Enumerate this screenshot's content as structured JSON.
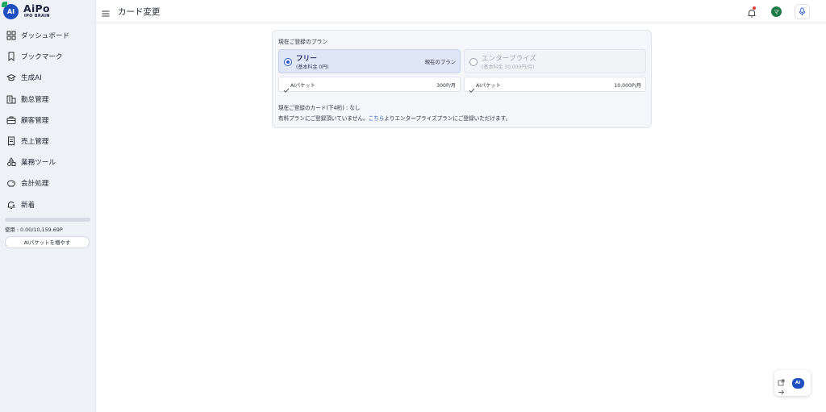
{
  "brand": {
    "badge": "AI",
    "name": "AiPo",
    "sub": "IPO BRAIN"
  },
  "sidebar": {
    "items": [
      {
        "label": "ダッシュボード",
        "icon": "dashboard-icon"
      },
      {
        "label": "ブックマーク",
        "icon": "bookmark-icon"
      },
      {
        "label": "生成AI",
        "icon": "graduation-cap-icon"
      },
      {
        "label": "勤怠管理",
        "icon": "building-icon"
      },
      {
        "label": "顧客管理",
        "icon": "briefcase-icon"
      },
      {
        "label": "売上管理",
        "icon": "receipt-icon"
      },
      {
        "label": "業務ツール",
        "icon": "shapes-icon"
      },
      {
        "label": "会計処理",
        "icon": "piggy-bank-icon"
      },
      {
        "label": "新着",
        "icon": "bell-plus-icon"
      }
    ],
    "usage_text": "使用 : 0.00/10,159.69P",
    "usage_fraction": 0.0,
    "add_packet_label": "AIパケットを増やす"
  },
  "header": {
    "title": "カード変更",
    "avatar_letter": "マ"
  },
  "plan_section": {
    "title": "現在ご登録のプラン",
    "plans": [
      {
        "name": "フリー",
        "sub": "(基本料金 0円)",
        "current_label": "現在のプラン",
        "selected": true
      },
      {
        "name": "エンタープライズ",
        "sub": "(基本料金 30,000円/月)",
        "selected": false
      }
    ],
    "packets": [
      {
        "label": "AIパケット",
        "price": "300P/月"
      },
      {
        "label": "AIパケット",
        "price": "10,000P/月"
      }
    ],
    "card_info": "現在ご登録のカード(下4桁) : なし",
    "note_before": "有料プランにご登録頂いていません。",
    "note_link": "こちら",
    "note_after": "よりエンタープライズプランにご登録いただけます。"
  },
  "fab": {
    "ai_label": "AI"
  },
  "colors": {
    "accent": "#2a56c6",
    "sidebar_bg": "#eef1f6",
    "selected_plan_bg": "#dfe6f6",
    "avatar": "#1e7a44",
    "notification_dot": "#e53935"
  }
}
